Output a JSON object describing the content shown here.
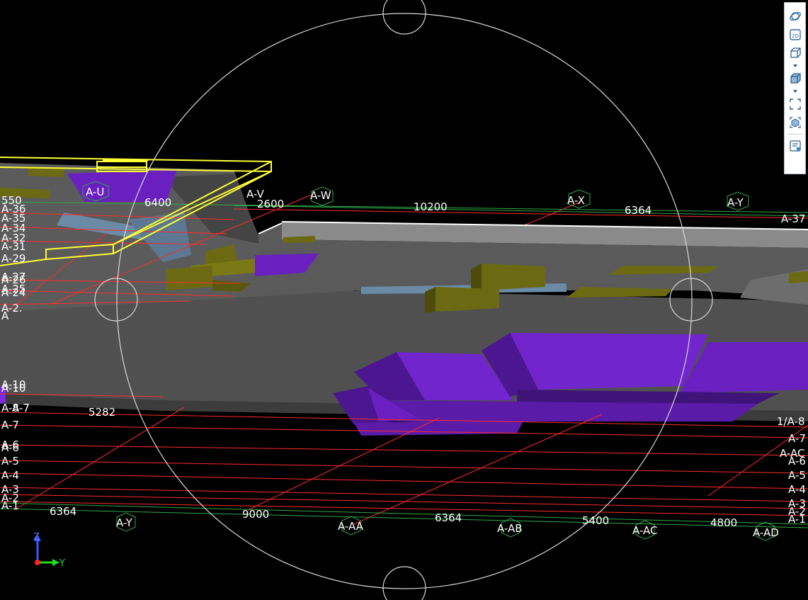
{
  "viewer": {
    "background": "#000000",
    "colors": {
      "grid_red": "#ff2a2a",
      "grid_green": "#2fa84a",
      "selection_yellow": "#ffff33",
      "slab_gray": "#5e5e5e",
      "wall_gray": "#7a7a7a",
      "olive": "#6b6a12",
      "purple": "#6a1fc0",
      "blue_gray": "#6b8aa5"
    }
  },
  "toolbar": {
    "buttons": [
      {
        "name": "orbit-icon"
      },
      {
        "name": "view-2d-icon",
        "label": "2D"
      },
      {
        "name": "wireframe-box-icon"
      },
      {
        "name": "shaded-box-icon"
      },
      {
        "name": "fit-view-icon"
      },
      {
        "name": "focus-object-icon"
      },
      {
        "name": "properties-list-icon"
      }
    ]
  },
  "grid_labels": {
    "top_axes": [
      "A-U",
      "A-V",
      "A-W",
      "A-X",
      "A-Y",
      "A-37"
    ],
    "top_dims": [
      "6400",
      "2600",
      "10200",
      "6364"
    ],
    "left_upper": [
      "550",
      "A-36",
      "A-35",
      "A-34",
      "A-32",
      "A-31",
      "A-29",
      "A-27",
      "A-26",
      "A-25",
      "A-24",
      "A-2.",
      "A"
    ],
    "left_lower": [
      "A-10",
      "A-10",
      "A-8",
      "A-7",
      "A-7",
      "A-6",
      "A-6",
      "A-5",
      "A-4",
      "A-3",
      "A-2",
      "A-1"
    ],
    "left_dim": "5282",
    "bottom_axes": [
      "A-Y",
      "A-AA",
      "A-AB",
      "A-AC",
      "A-AD"
    ],
    "bottom_dims": [
      "6364",
      "9000",
      "6364",
      "5400",
      "4800"
    ],
    "right_labels": [
      "1/A-8",
      "A-7",
      "A-AC",
      "A-6",
      "A-5",
      "A-4",
      "A-3",
      "A-2",
      "A-1"
    ]
  },
  "axis_triad": {
    "z": "Z",
    "y": "Y"
  }
}
